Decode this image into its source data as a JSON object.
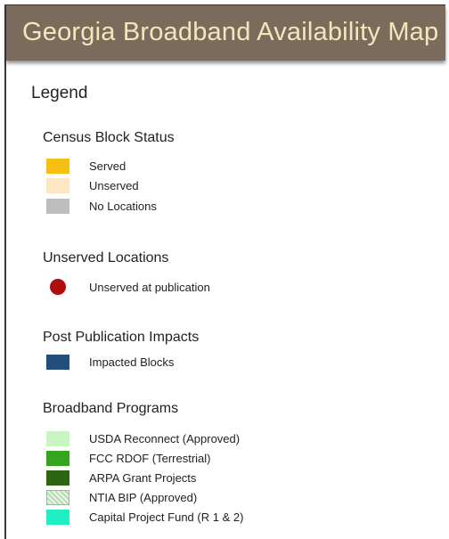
{
  "header": {
    "title": "Georgia Broadband Availability Map"
  },
  "legend": {
    "title": "Legend",
    "sections": [
      {
        "title": "Census Block Status",
        "items": [
          {
            "label": "Served",
            "color": "#f7bf14",
            "icon": "square-swatch"
          },
          {
            "label": "Unserved",
            "color": "#fde6c3",
            "icon": "square-swatch"
          },
          {
            "label": "No Locations",
            "color": "#bdbdbd",
            "icon": "square-swatch"
          }
        ]
      },
      {
        "title": "Unserved Locations",
        "items": [
          {
            "label": "Unserved at publication",
            "color": "#b00d0d",
            "icon": "circle-marker"
          }
        ]
      },
      {
        "title": "Post Publication Impacts",
        "items": [
          {
            "label": "Impacted Blocks",
            "color": "#234d7a",
            "icon": "square-swatch"
          }
        ]
      },
      {
        "title": "Broadband Programs",
        "items": [
          {
            "label": "USDA Reconnect (Approved)",
            "color": "#c9f5c2",
            "icon": "square-swatch"
          },
          {
            "label": "FCC RDOF (Terrestrial)",
            "color": "#35a51d",
            "icon": "square-swatch"
          },
          {
            "label": "ARPA Grant Projects",
            "color": "#2d6513",
            "icon": "square-swatch"
          },
          {
            "label": "NTIA BIP (Approved)",
            "color": "#d9ecd4",
            "icon": "hatched-swatch"
          },
          {
            "label": "Capital Project Fund (R 1 & 2)",
            "color": "#1ff0c3",
            "icon": "square-swatch"
          }
        ]
      }
    ]
  }
}
